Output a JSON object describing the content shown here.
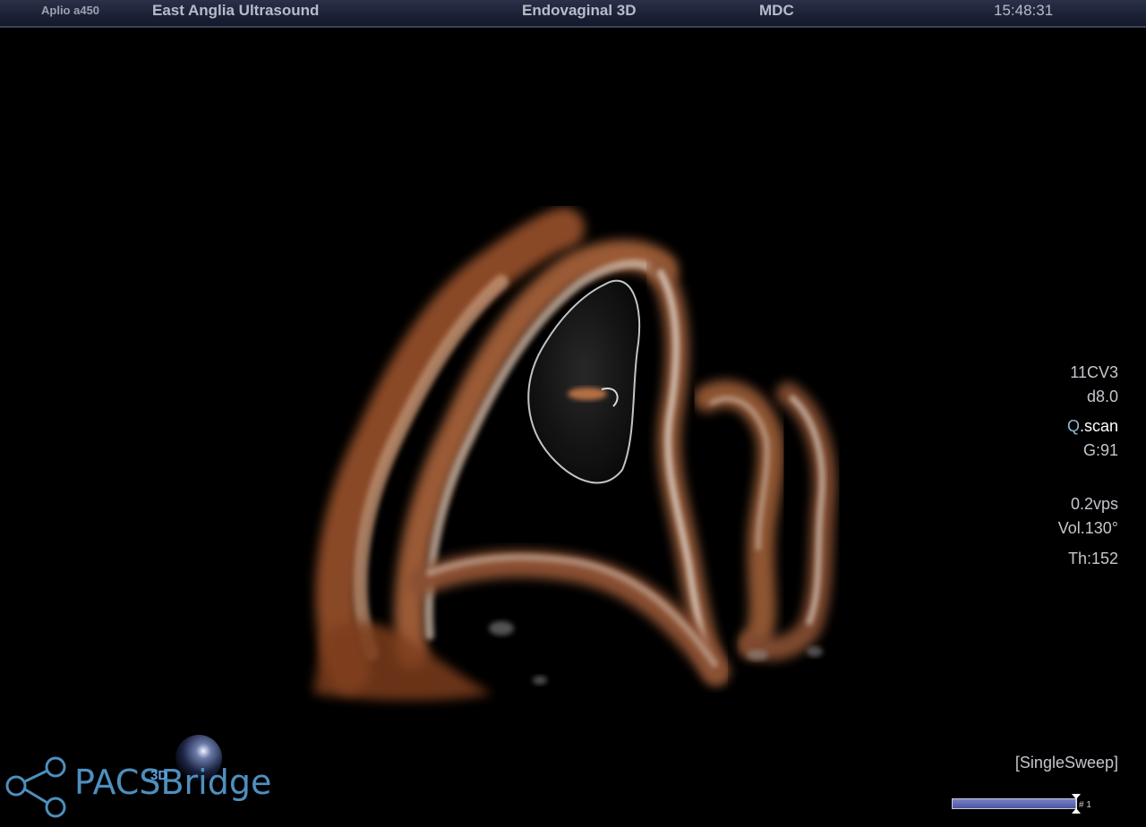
{
  "header": {
    "model": "Aplio a450",
    "institution": "East Anglia Ultrasound",
    "exam": "Endovaginal 3D",
    "operator": "MDC",
    "time": "15:48:31"
  },
  "parameters": {
    "transducer": "11CV3",
    "depth": "d8.0",
    "mode_prefix": "Q",
    "mode_suffix": ".scan",
    "gain": "G:91",
    "volume_rate": "0.2vps",
    "volume_angle": "Vol.130°",
    "threshold": "Th:152",
    "sweep_mode": "[SingleSweep]"
  },
  "sweep": {
    "progress": 1.0,
    "index_label": "# 1"
  },
  "logo": {
    "text": "PACSBridge",
    "badge": "3D"
  },
  "colors": {
    "header_bg": "#1c2236",
    "header_text": "#b7bccb",
    "info_text": "#c4c6cc",
    "logo_blue": "#4e8fbe",
    "sweep_fill": "#5a63b0",
    "tissue": "#b5673a"
  },
  "icons": {
    "logo_graphic": "molecule-network-icon",
    "sphere": "sphere-icon",
    "sweep_marker": "hourglass-marker-icon"
  }
}
